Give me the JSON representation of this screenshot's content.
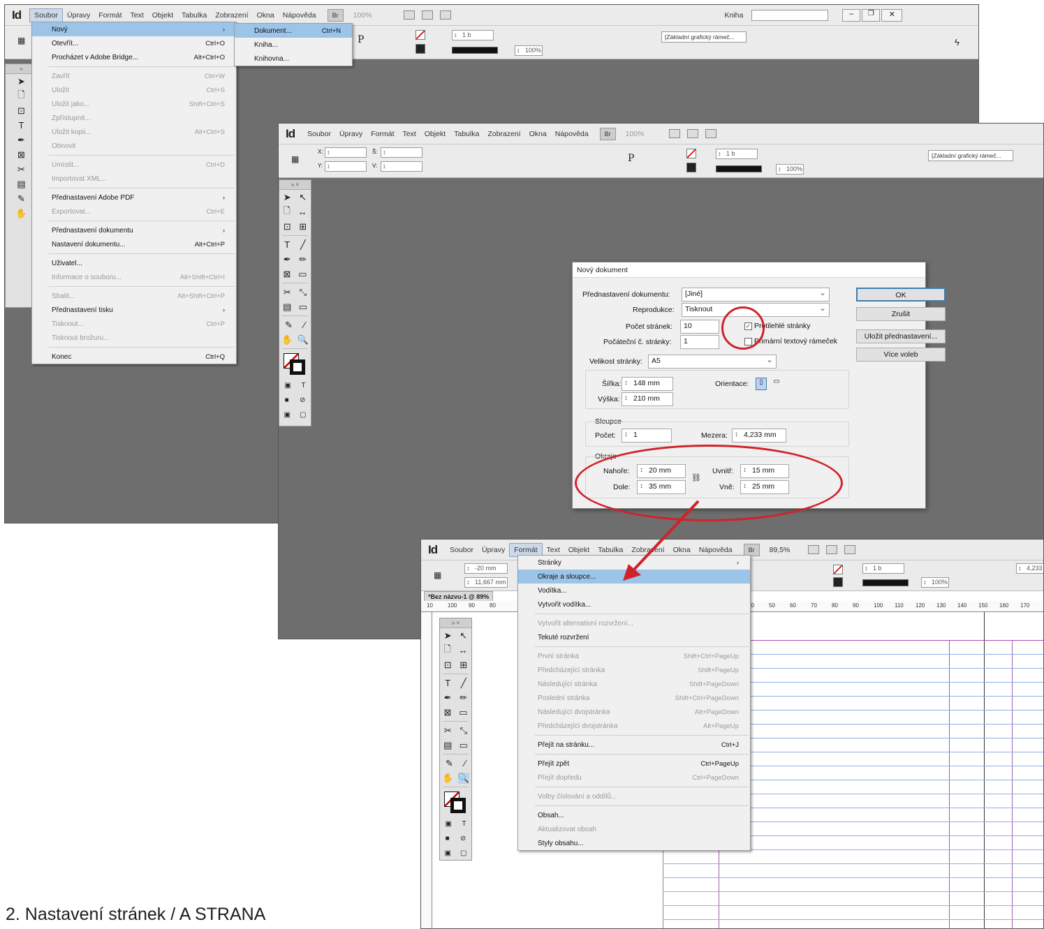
{
  "app": {
    "logo": "Id",
    "workspace": "Kniha"
  },
  "menubar": [
    "Soubor",
    "Úpravy",
    "Formát",
    "Text",
    "Objekt",
    "Tabulka",
    "Zobrazení",
    "Okna",
    "Nápověda"
  ],
  "menubar_misc": {
    "br": "Br",
    "zoom1": "100%",
    "zoom3": "89,5%"
  },
  "ctrl": {
    "x_label": "X:",
    "y_label": "Y:",
    "w_label": "Š:",
    "h_label": "V:",
    "stroke_w": "1 b",
    "pct": "100%",
    "frame": "[Základní grafický rámeč...",
    "x_val": "-20 mm",
    "y_val": "11,667 mm",
    "val4233": "4,233"
  },
  "file_menu": {
    "items": [
      {
        "label": "Nový",
        "shortcut": "",
        "arrow": "›",
        "state": "hl"
      },
      {
        "label": "Otevřít...",
        "shortcut": "Ctrl+O",
        "state": ""
      },
      {
        "label": "Procházet v Adobe Bridge...",
        "shortcut": "Alt+Ctrl+O",
        "state": ""
      },
      {
        "sep": true
      },
      {
        "label": "Zavřít",
        "shortcut": "Ctrl+W",
        "state": "dis"
      },
      {
        "label": "Uložit",
        "shortcut": "Ctrl+S",
        "state": "dis"
      },
      {
        "label": "Uložit jako...",
        "shortcut": "Shift+Ctrl+S",
        "state": "dis"
      },
      {
        "label": "Zpřístupnit...",
        "shortcut": "",
        "state": "dis"
      },
      {
        "label": "Uložit kopii...",
        "shortcut": "Alt+Ctrl+S",
        "state": "dis"
      },
      {
        "label": "Obnovit",
        "shortcut": "",
        "state": "dis"
      },
      {
        "sep": true
      },
      {
        "label": "Umístit...",
        "shortcut": "Ctrl+D",
        "state": "dis"
      },
      {
        "label": "Importovat XML...",
        "shortcut": "",
        "state": "dis"
      },
      {
        "sep": true
      },
      {
        "label": "Přednastavení Adobe PDF",
        "shortcut": "",
        "arrow": "›",
        "state": ""
      },
      {
        "label": "Exportovat...",
        "shortcut": "Ctrl+E",
        "state": "dis"
      },
      {
        "sep": true
      },
      {
        "label": "Přednastavení dokumentu",
        "shortcut": "",
        "arrow": "›",
        "state": ""
      },
      {
        "label": "Nastavení dokumentu...",
        "shortcut": "Alt+Ctrl+P",
        "state": ""
      },
      {
        "sep": true
      },
      {
        "label": "Uživatel...",
        "shortcut": "",
        "state": ""
      },
      {
        "label": "Informace o souboru...",
        "shortcut": "Alt+Shift+Ctrl+I",
        "state": "dis"
      },
      {
        "sep": true
      },
      {
        "label": "Sbalit...",
        "shortcut": "Alt+Shift+Ctrl+P",
        "state": "dis"
      },
      {
        "label": "Přednastavení tisku",
        "shortcut": "",
        "arrow": "›",
        "state": ""
      },
      {
        "label": "Tisknout...",
        "shortcut": "Ctrl+P",
        "state": "dis"
      },
      {
        "label": "Tisknout brožuru...",
        "shortcut": "",
        "state": "dis"
      },
      {
        "sep": true
      },
      {
        "label": "Konec",
        "shortcut": "Ctrl+Q",
        "state": ""
      }
    ]
  },
  "new_submenu": [
    {
      "label": "Dokument...",
      "shortcut": "Ctrl+N",
      "state": "hl"
    },
    {
      "label": "Kniha...",
      "shortcut": "",
      "state": ""
    },
    {
      "label": "Knihovna...",
      "shortcut": "",
      "state": ""
    }
  ],
  "dialog": {
    "title": "Nový dokument",
    "preset_label": "Přednastavení dokumentu:",
    "preset_value": "[Jiné]",
    "intent_label": "Reprodukce:",
    "intent_value": "Tisknout",
    "pages_label": "Počet stránek:",
    "pages_value": "10",
    "start_label": "Počáteční č. stránky:",
    "start_value": "1",
    "facing_label": "Protilehlé stránky",
    "primary_label": "Primární textový rámeček",
    "size_label": "Velikost stránky:",
    "size_value": "A5",
    "width_label": "Šířka:",
    "width_value": "148 mm",
    "height_label": "Výška:",
    "height_value": "210 mm",
    "orient_label": "Orientace:",
    "columns_group": "Sloupce",
    "count_label": "Počet:",
    "count_value": "1",
    "gutter_label": "Mezera:",
    "gutter_value": "4,233 mm",
    "margins_group": "Okraje",
    "top_label": "Nahoře:",
    "top_value": "20 mm",
    "bottom_label": "Dole:",
    "bottom_value": "35 mm",
    "inside_label": "Uvnitř:",
    "inside_value": "15 mm",
    "outside_label": "Vně:",
    "outside_value": "25 mm",
    "ok": "OK",
    "cancel": "Zrušit",
    "save_preset": "Uložit přednastavení...",
    "more": "Více voleb"
  },
  "doc_tab": "*Bez názvu-1 @ 89%",
  "ruler_nums": [
    "10",
    "100",
    "90",
    "80",
    "40",
    "50",
    "60",
    "70",
    "80",
    "90",
    "100",
    "110",
    "120",
    "130",
    "140",
    "150",
    "160",
    "170"
  ],
  "format_menu": [
    {
      "label": "Stránky",
      "shortcut": "",
      "arrow": "›",
      "state": ""
    },
    {
      "label": "Okraje a sloupce...",
      "shortcut": "",
      "state": "hl"
    },
    {
      "label": "Vodítka...",
      "shortcut": "",
      "state": ""
    },
    {
      "label": "Vytvořit vodítka...",
      "shortcut": "",
      "state": ""
    },
    {
      "sep": true
    },
    {
      "label": "Vytvořit alternativní rozvržení...",
      "shortcut": "",
      "state": "dis"
    },
    {
      "label": "Tekuté rozvržení",
      "shortcut": "",
      "state": ""
    },
    {
      "sep": true
    },
    {
      "label": "První stránka",
      "shortcut": "Shift+Ctrl+PageUp",
      "state": "dis"
    },
    {
      "label": "Předcházející stránka",
      "shortcut": "Shift+PageUp",
      "state": "dis"
    },
    {
      "label": "Následující stránka",
      "shortcut": "Shift+PageDown",
      "state": "dis"
    },
    {
      "label": "Poslední stránka",
      "shortcut": "Shift+Ctrl+PageDown",
      "state": "dis"
    },
    {
      "label": "Následující dvojstránka",
      "shortcut": "Alt+PageDown",
      "state": "dis"
    },
    {
      "label": "Předcházející dvojstránka",
      "shortcut": "Alt+PageUp",
      "state": "dis"
    },
    {
      "sep": true
    },
    {
      "label": "Přejít na stránku...",
      "shortcut": "Ctrl+J",
      "state": ""
    },
    {
      "sep": true
    },
    {
      "label": "Přejít zpět",
      "shortcut": "Ctrl+PageUp",
      "state": ""
    },
    {
      "label": "Přejít dopředu",
      "shortcut": "Ctrl+PageDown",
      "state": "dis"
    },
    {
      "sep": true
    },
    {
      "label": "Volby číslování a oddílů...",
      "shortcut": "",
      "state": "dis"
    },
    {
      "sep": true
    },
    {
      "label": "Obsah...",
      "shortcut": "",
      "state": ""
    },
    {
      "label": "Aktualizovat obsah",
      "shortcut": "",
      "state": "dis"
    },
    {
      "label": "Styly obsahu...",
      "shortcut": "",
      "state": ""
    }
  ],
  "caption": "2. Nastavení stránek / A STRANA",
  "colors": {
    "annotation": "#d0222a",
    "highlight": "#9cc3e8",
    "canvas": "#6e6e6e"
  }
}
